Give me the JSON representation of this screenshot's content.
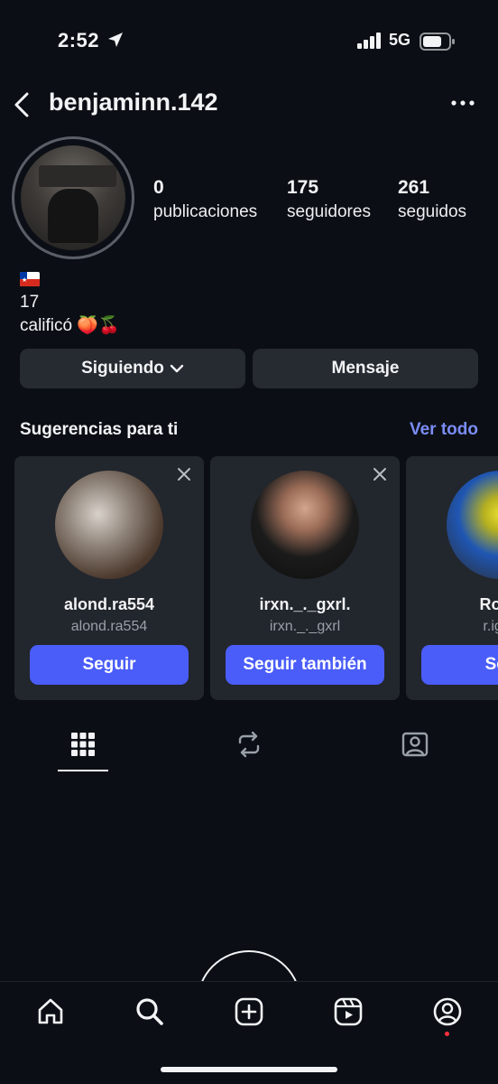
{
  "status_bar": {
    "time": "2:52",
    "network": "5G"
  },
  "header": {
    "username": "benjaminn.142"
  },
  "stats": {
    "posts": {
      "value": "0",
      "label": "publicaciones"
    },
    "followers": {
      "value": "175",
      "label": "seguidores"
    },
    "following": {
      "value": "261",
      "label": "seguidos"
    }
  },
  "bio": {
    "line2": "17",
    "line3": "calificó 🍑🍒"
  },
  "actions": {
    "following_label": "Siguiendo",
    "message_label": "Mensaje"
  },
  "suggestions": {
    "title": "Sugerencias para ti",
    "see_all": "Ver todo",
    "cards": [
      {
        "name": "alond.ra554",
        "handle": "alond.ra554",
        "button": "Seguir"
      },
      {
        "name": "irxn._._gxrl.",
        "handle": "irxn._._gxrl",
        "button": "Seguir también"
      },
      {
        "name": "Rodri",
        "handle": "r.igna",
        "button": "Seg"
      }
    ]
  },
  "colors": {
    "background": "#0b0f15",
    "button_gray": "#262a31",
    "accent_blue": "#4a5df9",
    "link_blue": "#7b8cf6",
    "notification_red": "#ff3040"
  },
  "icons": {
    "back": "chevron-left-icon",
    "more": "more-horizontal-icon",
    "tab_grid": "grid-icon",
    "tab_reposts": "repost-icon",
    "tab_tagged": "tagged-person-icon",
    "nav_home": "home-icon",
    "nav_search": "search-icon",
    "nav_create": "plus-square-icon",
    "nav_reels": "reels-icon",
    "nav_profile": "profile-icon"
  }
}
